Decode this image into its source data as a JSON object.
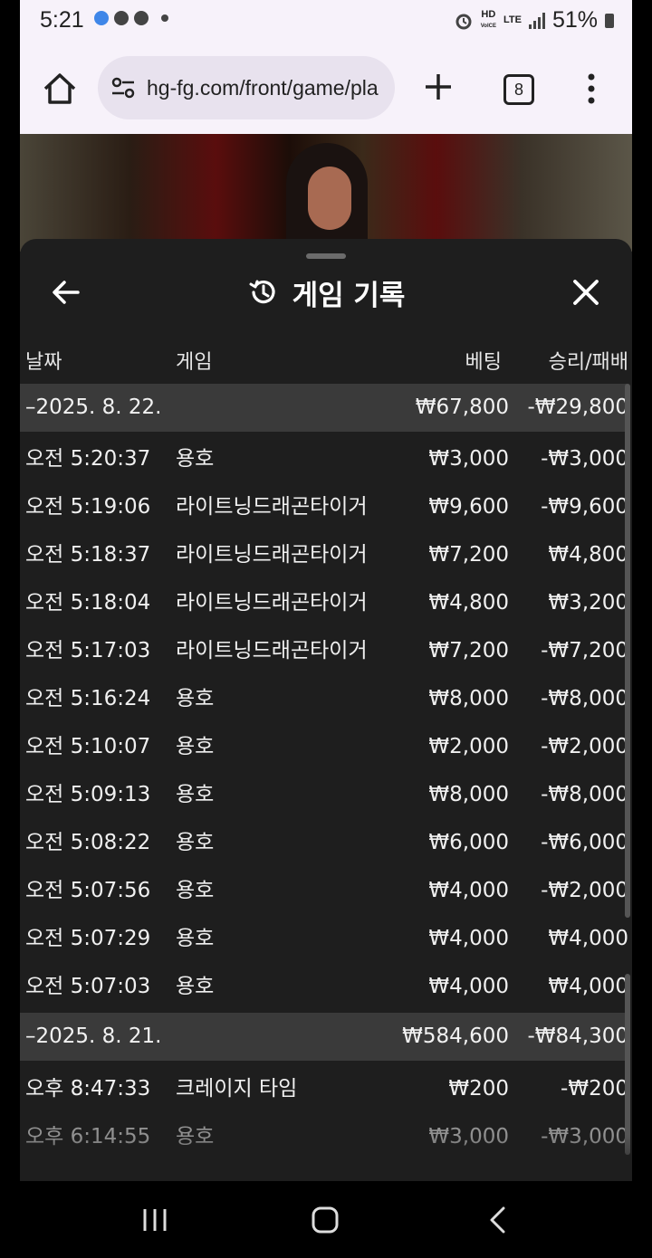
{
  "status_bar": {
    "time": "5:21",
    "battery": "51%",
    "hd_label": "HD",
    "voice_label": "VoICE",
    "lte_label": "LTE"
  },
  "browser": {
    "url": "hg-fg.com/front/game/pla",
    "tab_count": "8"
  },
  "sheet": {
    "title": "게임 기록",
    "columns": {
      "date": "날짜",
      "game": "게임",
      "bet": "베팅",
      "result": "승리/패배"
    },
    "groups": [
      {
        "date": "–2025. 8. 22.",
        "bet_total": "₩67,800",
        "result_total": "-₩29,800",
        "rows": [
          {
            "time": "오전 5:20:37",
            "game": "용호",
            "bet": "₩3,000",
            "result": "-₩3,000"
          },
          {
            "time": "오전 5:19:06",
            "game": "라이트닝드래곤타이거",
            "bet": "₩9,600",
            "result": "-₩9,600"
          },
          {
            "time": "오전 5:18:37",
            "game": "라이트닝드래곤타이거",
            "bet": "₩7,200",
            "result": "₩4,800"
          },
          {
            "time": "오전 5:18:04",
            "game": "라이트닝드래곤타이거",
            "bet": "₩4,800",
            "result": "₩3,200"
          },
          {
            "time": "오전 5:17:03",
            "game": "라이트닝드래곤타이거",
            "bet": "₩7,200",
            "result": "-₩7,200"
          },
          {
            "time": "오전 5:16:24",
            "game": "용호",
            "bet": "₩8,000",
            "result": "-₩8,000"
          },
          {
            "time": "오전 5:10:07",
            "game": "용호",
            "bet": "₩2,000",
            "result": "-₩2,000"
          },
          {
            "time": "오전 5:09:13",
            "game": "용호",
            "bet": "₩8,000",
            "result": "-₩8,000"
          },
          {
            "time": "오전 5:08:22",
            "game": "용호",
            "bet": "₩6,000",
            "result": "-₩6,000"
          },
          {
            "time": "오전 5:07:56",
            "game": "용호",
            "bet": "₩4,000",
            "result": "-₩2,000"
          },
          {
            "time": "오전 5:07:29",
            "game": "용호",
            "bet": "₩4,000",
            "result": "₩4,000"
          },
          {
            "time": "오전 5:07:03",
            "game": "용호",
            "bet": "₩4,000",
            "result": "₩4,000"
          }
        ]
      },
      {
        "date": "–2025. 8. 21.",
        "bet_total": "₩584,600",
        "result_total": "-₩84,300",
        "rows": [
          {
            "time": "오후 8:47:33",
            "game": "크레이지 타임",
            "bet": "₩200",
            "result": "-₩200"
          },
          {
            "time": "오후 6:14:55",
            "game": "용호",
            "bet": "₩3,000",
            "result": "-₩3,000"
          }
        ]
      }
    ]
  }
}
